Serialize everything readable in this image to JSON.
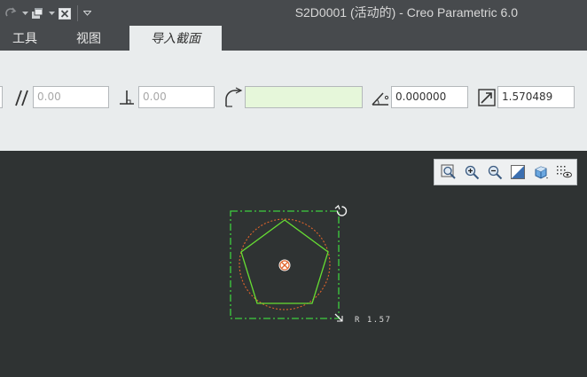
{
  "window": {
    "title": "S2D0001 (活动的) - Creo Parametric 6.0"
  },
  "quick_access": {
    "icons": [
      "redo-icon",
      "dropdown-arrow-icon",
      "windows-icon",
      "dropdown-arrow-icon",
      "close-window-icon",
      "customize-toolbar-icon"
    ]
  },
  "tabs": [
    {
      "label": "工具",
      "active": false
    },
    {
      "label": "视图",
      "active": false
    },
    {
      "label": "导入截面",
      "active": true
    }
  ],
  "ribbon": {
    "parallel_value": "0.00",
    "perpendicular_value": "0.00",
    "radius_value": "",
    "angle_value": "0.000000",
    "scale_value": "1.570489"
  },
  "view_toolbar": {
    "buttons": [
      "zoom-to-fit-icon",
      "zoom-in-icon",
      "zoom-out-icon",
      "repaint-icon",
      "display-style-icon",
      "sketch-display-filter-icon"
    ]
  },
  "sketch": {
    "dimension_label": "R 1.57",
    "colors": {
      "bounding_box": "#3ecf3e",
      "circle": "#e0642a",
      "pentagon": "#66dd33",
      "center": "#e0642a"
    }
  }
}
